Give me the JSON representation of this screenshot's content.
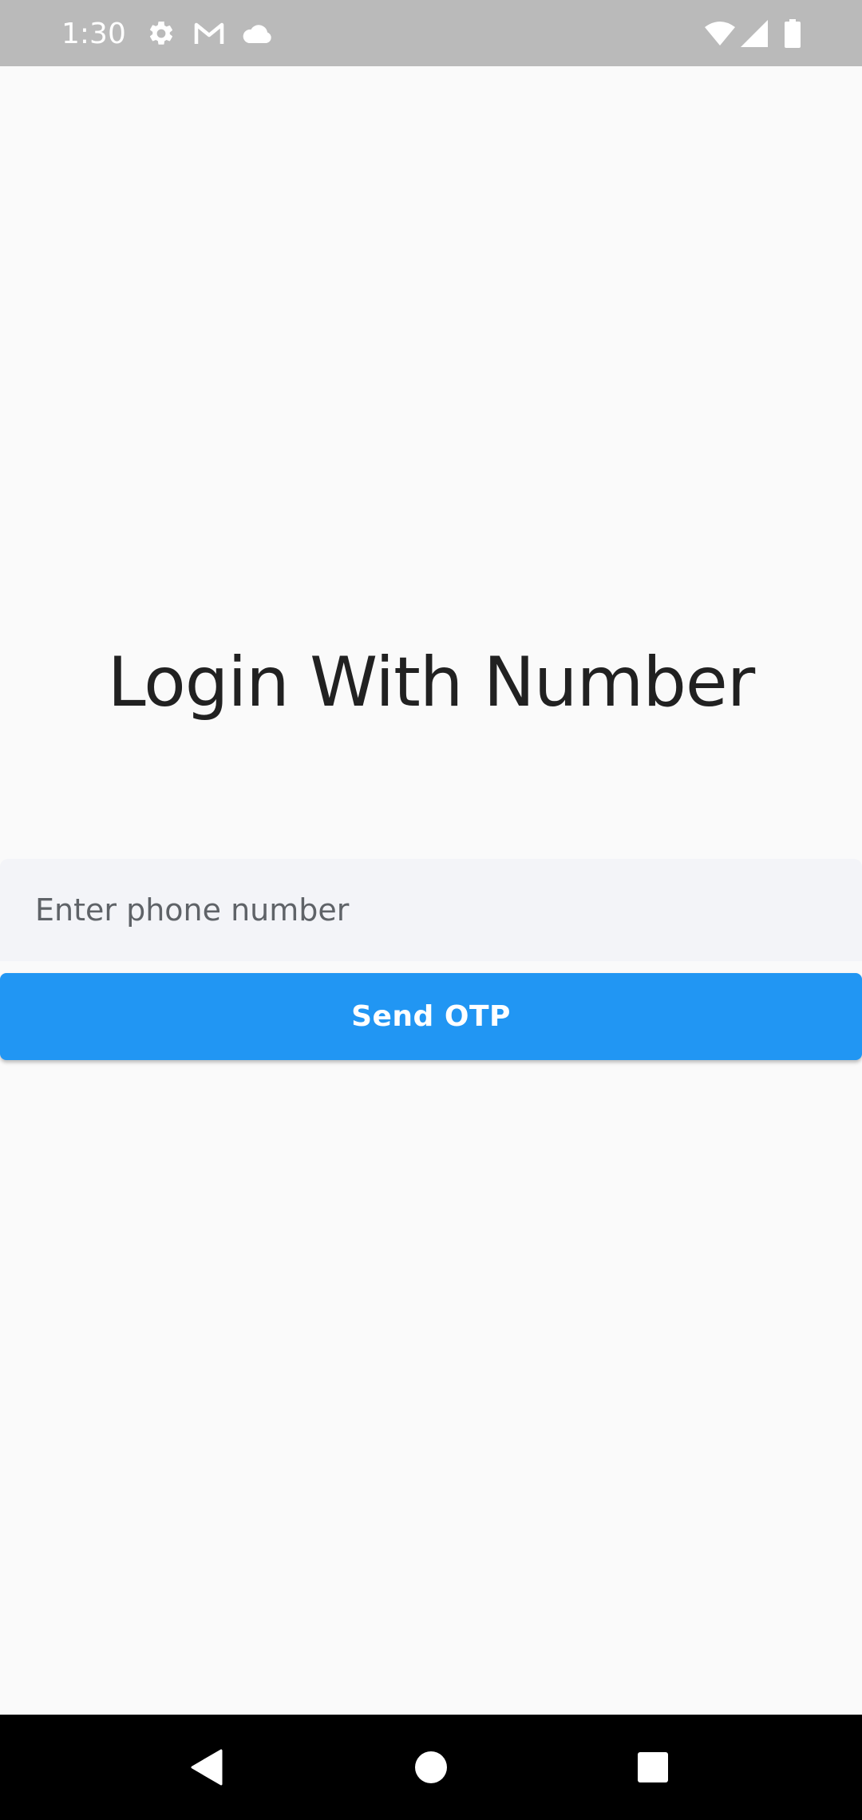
{
  "status_bar": {
    "time": "1:30",
    "left_icons": [
      "settings-icon",
      "gmail-icon",
      "cloud-icon"
    ],
    "right_icons": [
      "wifi-icon",
      "signal-icon",
      "battery-icon"
    ]
  },
  "main": {
    "title": "Login With Number",
    "phone_input": {
      "placeholder": "Enter phone number",
      "value": ""
    },
    "send_button_label": "Send OTP"
  },
  "nav_bar": {
    "buttons": [
      "back-icon",
      "home-icon",
      "recents-icon"
    ]
  },
  "colors": {
    "accent": "#2196f3",
    "status_bar": "#bababa",
    "background": "#fafafa",
    "input_background": "#f3f4f8",
    "title_text": "#212121",
    "nav_bar": "#000000"
  }
}
